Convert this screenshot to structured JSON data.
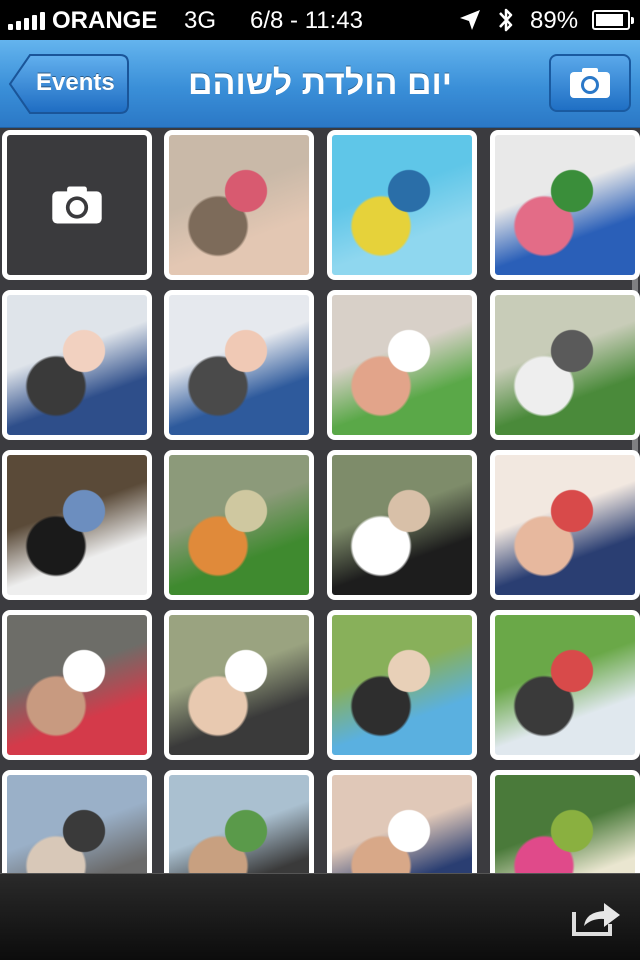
{
  "status_bar": {
    "carrier": "ORANGE",
    "network": "3G",
    "time": "6/8 - 11:43",
    "battery_pct": "89%",
    "battery_level": 0.89
  },
  "nav": {
    "back_label": "Events",
    "title": "יום הולדת לשוהם"
  },
  "photos": [
    {
      "kind": "camera",
      "icon": "camera-icon"
    },
    {
      "kind": "photo",
      "colors": [
        "#c9b9a8",
        "#e3c7b3",
        "#7d6b5a",
        "#d85a70"
      ]
    },
    {
      "kind": "photo",
      "colors": [
        "#5fc6e8",
        "#8fd7ef",
        "#e6d23a",
        "#2a6ea8"
      ]
    },
    {
      "kind": "photo",
      "colors": [
        "#e9e9e9",
        "#2a5fb8",
        "#e36c87",
        "#3a8e3a"
      ]
    },
    {
      "kind": "photo",
      "colors": [
        "#dfe4ea",
        "#2e4e8a",
        "#3a3a3a",
        "#f2d1c0"
      ]
    },
    {
      "kind": "photo",
      "colors": [
        "#e6e9ee",
        "#2e5a9c",
        "#4a4a4a",
        "#f0c9b5"
      ]
    },
    {
      "kind": "photo",
      "colors": [
        "#d8d0c8",
        "#5aa848",
        "#e2a48a",
        "#ffffff"
      ]
    },
    {
      "kind": "photo",
      "colors": [
        "#c8ccb8",
        "#4a8a3a",
        "#eeeeee",
        "#5a5a5a"
      ]
    },
    {
      "kind": "photo",
      "colors": [
        "#5a4a38",
        "#eeeeee",
        "#1a1a1a",
        "#6c8ebf"
      ]
    },
    {
      "kind": "photo",
      "colors": [
        "#8c9a7a",
        "#3f8a2f",
        "#e08a3a",
        "#cfc8a0"
      ]
    },
    {
      "kind": "photo",
      "colors": [
        "#7e8c6a",
        "#1d1d1d",
        "#ffffff",
        "#d8c0a8"
      ]
    },
    {
      "kind": "photo",
      "colors": [
        "#f2e8e0",
        "#2a3e72",
        "#e7b89e",
        "#d84a4a"
      ]
    },
    {
      "kind": "photo",
      "colors": [
        "#6d6d68",
        "#d43a4a",
        "#c89a80",
        "#ffffff"
      ]
    },
    {
      "kind": "photo",
      "colors": [
        "#9aa380",
        "#3a3a3a",
        "#e8c9b0",
        "#ffffff"
      ]
    },
    {
      "kind": "photo",
      "colors": [
        "#88b05a",
        "#5ab0e0",
        "#2e2e2e",
        "#e8d0b8"
      ]
    },
    {
      "kind": "photo",
      "colors": [
        "#6aa848",
        "#e0e8ee",
        "#3a3a3a",
        "#d84a4a"
      ]
    },
    {
      "kind": "photo",
      "colors": [
        "#9ab0c8",
        "#6a6a6a",
        "#d8c8b8",
        "#3a3a3a"
      ]
    },
    {
      "kind": "photo",
      "colors": [
        "#aac0d0",
        "#3a3a3a",
        "#c8a080",
        "#5a9a4a"
      ]
    },
    {
      "kind": "photo",
      "colors": [
        "#e0c8b8",
        "#2a3e72",
        "#d8a888",
        "#ffffff"
      ]
    },
    {
      "kind": "photo",
      "colors": [
        "#4a7a3a",
        "#eae6d0",
        "#e04a8a",
        "#8ab040"
      ]
    }
  ]
}
